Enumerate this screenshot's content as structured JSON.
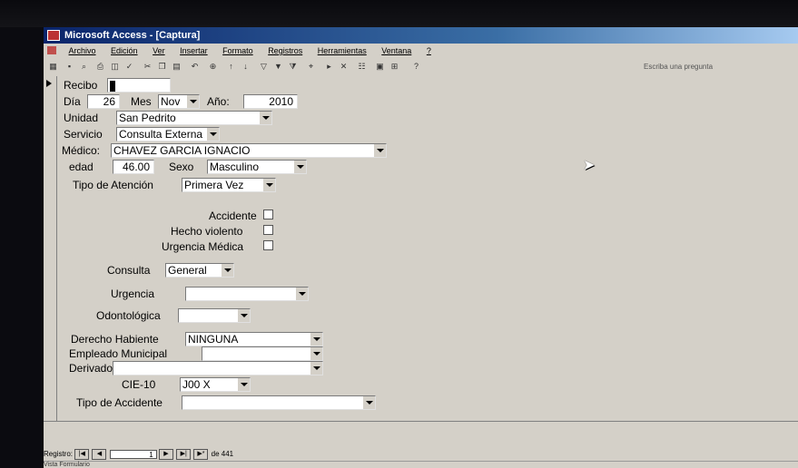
{
  "window": {
    "title": "Microsoft Access - [Captura]"
  },
  "menu": [
    "Archivo",
    "Edición",
    "Ver",
    "Insertar",
    "Formato",
    "Registros",
    "Herramientas",
    "Ventana",
    "?"
  ],
  "toolbar": {
    "ask_placeholder": "Escriba una pregunta"
  },
  "form": {
    "recibo": {
      "label": "Recibo",
      "value": ""
    },
    "dia": {
      "label": "Día",
      "value": "26"
    },
    "mes": {
      "label": "Mes",
      "value": "Nov"
    },
    "anio": {
      "label": "Año:",
      "value": "2010"
    },
    "unidad": {
      "label": "Unidad",
      "value": "San Pedrito"
    },
    "servicio": {
      "label": "Servicio",
      "value": "Consulta Externa"
    },
    "medico": {
      "label": "Médico:",
      "value": "CHAVEZ GARCIA IGNACIO"
    },
    "edad": {
      "label": "edad",
      "value": "46.00"
    },
    "sexo": {
      "label": "Sexo",
      "value": "Masculino"
    },
    "tipo_atencion": {
      "label": "Tipo de Atención",
      "value": "Primera Vez"
    },
    "accidente": {
      "label": "Accidente",
      "checked": false
    },
    "hecho_violento": {
      "label": "Hecho violento",
      "checked": false
    },
    "urgencia_medica": {
      "label": "Urgencia Médica",
      "checked": false
    },
    "consulta": {
      "label": "Consulta",
      "value": "General"
    },
    "urgencia": {
      "label": "Urgencia",
      "value": ""
    },
    "odontologica": {
      "label": "Odontológica",
      "value": ""
    },
    "derecho_habiente": {
      "label": "Derecho Habiente",
      "value": "NINGUNA"
    },
    "empleado_municipal": {
      "label": "Empleado Municipal",
      "value": ""
    },
    "derivado": {
      "label": "Derivado",
      "value": ""
    },
    "cie10": {
      "label": "CIE-10",
      "value": "J00 X"
    },
    "tipo_accidente": {
      "label": "Tipo de Accidente",
      "value": ""
    }
  },
  "navigation": {
    "label": "Registro:",
    "current": "1",
    "total_label": "de 441"
  },
  "status": {
    "text": "Vista Formulario"
  }
}
